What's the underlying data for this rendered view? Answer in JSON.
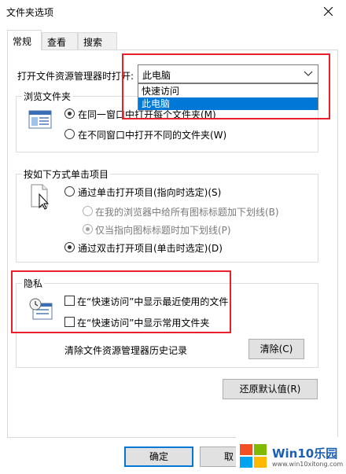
{
  "window": {
    "title": "文件夹选项"
  },
  "tabs": [
    {
      "label": "常规",
      "active": true
    },
    {
      "label": "查看",
      "active": false
    },
    {
      "label": "搜索",
      "active": false
    }
  ],
  "general": {
    "open_explorer_label": "打开文件资源管理器时打开:",
    "open_explorer_value": "此电脑",
    "open_explorer_options": [
      "快速访问",
      "此电脑"
    ],
    "browse_folders": {
      "title": "浏览文件夹",
      "same_window": "在同一窗口中打开每个文件夹(M)",
      "new_window": "在不同窗口中打开不同的文件夹(W)"
    },
    "click_items": {
      "title": "按如下方式单击项目",
      "single_click": "通过单击打开项目(指向时选定)(S)",
      "underline_all": "在我的浏览器中给所有图标标题加下划线(B)",
      "underline_point": "仅当指向图标标题时加下划线(P)",
      "double_click": "通过双击打开项目(单击时选定)(D)"
    },
    "privacy": {
      "title": "隐私",
      "recent_files": "在“快速访问”中显示最近使用的文件",
      "frequent_folders": "在“快速访问”中显示常用文件夹",
      "clear_history_label": "清除文件资源管理器历史记录",
      "clear_button": "清除(C)"
    },
    "restore_defaults_button": "还原默认值(R)"
  },
  "footer": {
    "ok_button": "确定",
    "cancel_button": "取"
  },
  "watermark": {
    "brand": "Win10乐园",
    "url": "www.win10xitong.com"
  },
  "colors": {
    "highlight": "#0078d7",
    "annotation": "#e8202a",
    "disabled_text": "#7a7a7a"
  },
  "icons": {
    "close": "close-icon",
    "chevron": "chevron-down-icon",
    "browse": "window-preview-icon",
    "click": "cursor-document-icon",
    "privacy": "clock-document-icon",
    "logo": "windows-logo-icon"
  }
}
